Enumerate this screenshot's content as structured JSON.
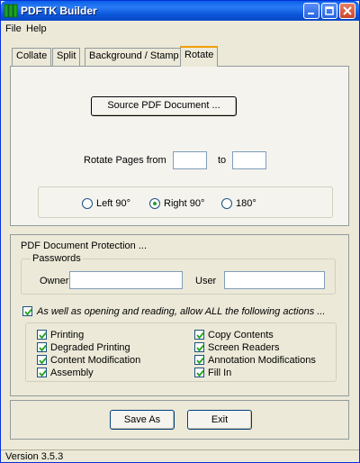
{
  "window": {
    "title": "PDFTK Builder"
  },
  "menu": {
    "file": "File",
    "help": "Help"
  },
  "tabs": [
    {
      "label": "Collate"
    },
    {
      "label": "Split"
    },
    {
      "label": "Background / Stamp"
    },
    {
      "label": "Rotate"
    }
  ],
  "rotate": {
    "source_button": "Source PDF Document ...",
    "pages_label": "Rotate Pages from",
    "from_value": "",
    "to_label": "to",
    "to_value": "",
    "options": [
      {
        "label": "Left 90°",
        "checked": false
      },
      {
        "label": "Right 90°",
        "checked": true
      },
      {
        "label": "180°",
        "checked": false
      }
    ]
  },
  "protection": {
    "title": "PDF Document Protection ...",
    "passwords_legend": "Passwords",
    "owner_label": "Owner",
    "owner_value": "",
    "user_label": "User",
    "user_value": "",
    "allow_label": "As well as opening and reading, allow ALL the following actions ...",
    "allow_checked": true,
    "permissions": [
      {
        "label": "Printing",
        "checked": true
      },
      {
        "label": "Degraded Printing",
        "checked": true
      },
      {
        "label": "Content Modification",
        "checked": true
      },
      {
        "label": "Assembly",
        "checked": true
      },
      {
        "label": "Copy Contents",
        "checked": true
      },
      {
        "label": "Screen Readers",
        "checked": true
      },
      {
        "label": "Annotation Modifications",
        "checked": true
      },
      {
        "label": "Fill In",
        "checked": true
      }
    ]
  },
  "actions": {
    "save_as": "Save As",
    "exit": "Exit"
  },
  "status": {
    "version": "Version 3.5.3"
  },
  "colors": {
    "titlebar": "#0a56d8",
    "active_tab_accent": "#f0a000",
    "check_mark": "#21a121"
  }
}
